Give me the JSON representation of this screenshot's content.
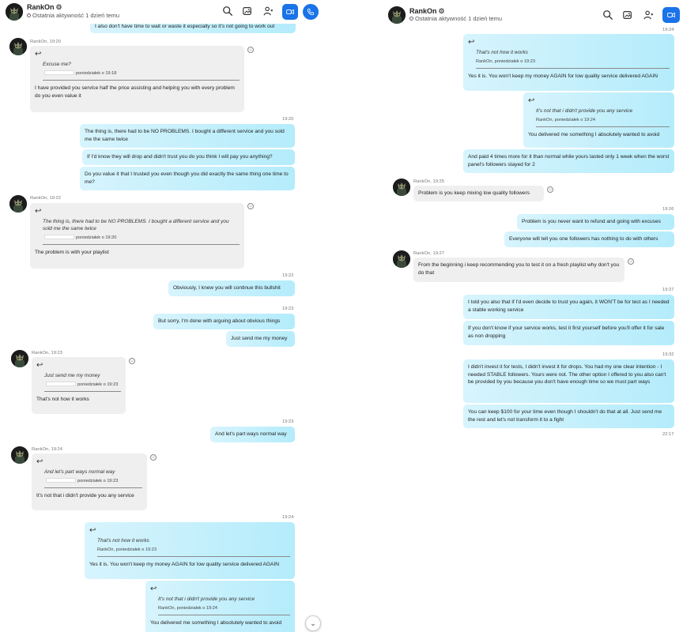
{
  "contact": {
    "name": "RankOn",
    "status": "Ostatnia aktywność 1 dzień temu"
  },
  "icons": {
    "search": "search-icon",
    "gallery": "gallery-icon",
    "add_people": "add-people-icon",
    "video": "video-call-icon",
    "call": "phone-call-icon",
    "settings": "gear-icon",
    "reply": "reply-arrow-icon",
    "reaction": "emoji-reaction-icon",
    "scroll": "chevron-down-icon"
  },
  "colors": {
    "outgoing_start": "#d7f4fd",
    "outgoing_end": "#b4ecfb",
    "incoming": "#efefef",
    "accent": "#1a73e8"
  },
  "left": {
    "top_bubble": "I also don't have time to wait or waste it especially so it's not going to work out",
    "g1": {
      "sender": "RankOn, 19:20",
      "quote_text": "Excuse me?",
      "quote_meta": "poniedziałek o 19:18",
      "text": "I have provided you service half the price assisting and helping you with every problem do you even value it"
    },
    "g2": {
      "time": "19:20",
      "m1": "The thing is, there had to be NO PROBLEMS. I bought a different service and you sold me the same twice",
      "m2": "If I'd know they will drop and didn't trust you do you think I will pay you anything?",
      "m3": "Do you value it that I trusted you even though you did exactly the same thing one time to me?"
    },
    "g3": {
      "sender": "RankOn, 19:22",
      "quote_text": "The thing is, there had to be NO PROBLEMS. I bought a different service and you sold me the same twice",
      "quote_meta": "poniedziałek o 19:20",
      "text": "The problem is with your playlist"
    },
    "g4": {
      "time": "19:22",
      "m1": "Obviously, I knew you will continue this bullshit"
    },
    "g5": {
      "time": "19:23",
      "m1": "But sorry, I'm done with arguing about obvious things",
      "m2": "Just send me my money"
    },
    "g6": {
      "sender": "RankOn, 19:23",
      "quote_text": "Just send me my money",
      "quote_meta": "poniedziałek o 19:23",
      "text": "That's not how it works"
    },
    "g7": {
      "time": "19:23",
      "m1": "And let's part ways normal way"
    },
    "g8": {
      "sender": "RankOn, 19:24",
      "quote_text": "And let's part ways normal way",
      "quote_meta": "poniedziałek o 19:23",
      "text": "It's not that i didn't provide you any service"
    },
    "g9": {
      "time": "19:24",
      "quote1_text": "That's not how it works",
      "quote1_meta": "RankOn, poniedziałek o 19:23",
      "m1": "Yes it is. You won't keep my money AGAIN for low quality service delivered AGAIN",
      "quote2_text": "It's not that i didn't provide you any service",
      "quote2_meta": "RankOn, poniedziałek o 19:24",
      "m2": "You delivered me something I absolutely wanted to avoid"
    }
  },
  "right": {
    "r1": {
      "time": "19:24",
      "quote1_text": "That's not how it works",
      "quote1_meta": "RankOn, poniedziałek o 19:23",
      "m1": "Yes it is. You won't keep my money AGAIN for low quality service delivered AGAIN",
      "quote2_text": "It's not that i didn't provide you any service",
      "quote2_meta": "RankOn, poniedziałek o 19:24",
      "m2": "You delivered me something I absolutely wanted to avoid",
      "m3": "And paid 4 times more for it than normal while yours lasted only 1 week when the worst panel's followers stayed for 2"
    },
    "r2": {
      "sender": "RankOn, 19:25",
      "text": "Problem is you keep mixing low quality followers"
    },
    "r3": {
      "time": "19:26",
      "m1": "Problem is you never want to refund and going with excuses",
      "m2": "Everyone will tell you one followers has nothing to do with others"
    },
    "r4": {
      "sender": "RankOn, 19:27",
      "text": "From the beginning i keep recommending you to test it on a fresh playlist why don't you do that"
    },
    "r5": {
      "time": "19:27",
      "m1": "I told you also that if I'd even decide to trust you again, it WON'T be for test as I needed a stable working service",
      "m2": "If you don't know if your service works, test it first yourself before you'll offer it for sale as non dropping"
    },
    "r6": {
      "time": "19:32",
      "m1": "I didn't invest it for tests, I didn't invest it for drops. You had my one clear intention - I needed STABLE followers. Yours were not. The other option I offered to you also can't be provided by you because you don't have enough time so we must part ways",
      "m2": "You can keep $100 for your time even though I shouldn't do that at all. Just send me the rest and let's not transform it to a fight",
      "time_after": "22:17"
    }
  }
}
